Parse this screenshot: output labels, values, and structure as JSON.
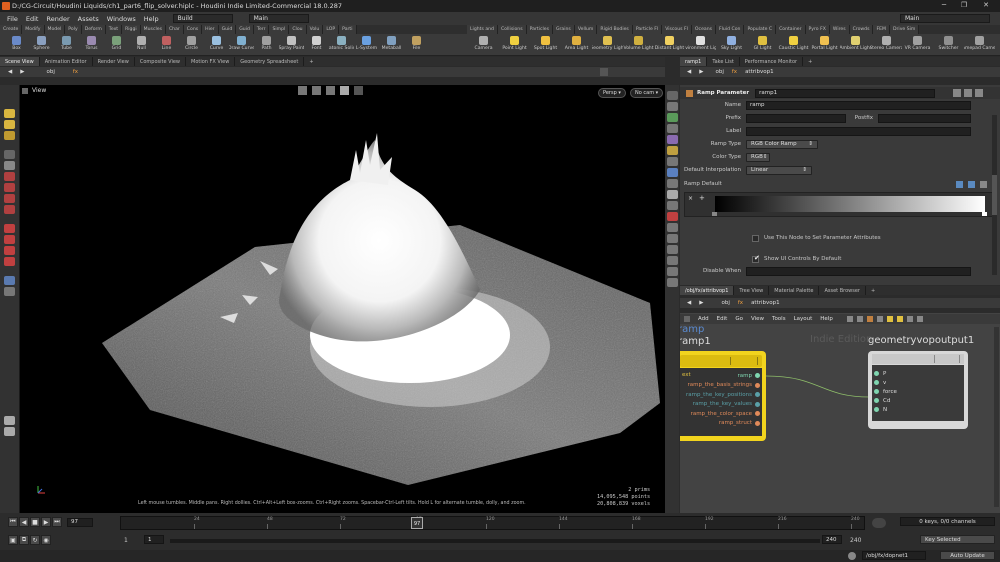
{
  "window": {
    "title": "D:/CG-Circuit/Houdini Liquids/ch1_part6_flip_solver.hiplc - Houdini Indie Limited-Commercial 18.0.287",
    "controls": [
      "─",
      "❐",
      "✕"
    ]
  },
  "menubar": {
    "items": [
      "File",
      "Edit",
      "Render",
      "Assets",
      "Windows",
      "Help"
    ],
    "desktop": "Build",
    "context": "Main",
    "right_context": "Main"
  },
  "shelf_tabs_left": [
    "Create",
    "Modify",
    "Model",
    "Poly",
    "Deform",
    "Text",
    "Riggi",
    "Muscles",
    "Char",
    "Cons",
    "Hier",
    "Guid",
    "Guid",
    "Terr",
    "Simpl",
    "Clou",
    "Volu",
    "LOP",
    "Parti"
  ],
  "shelf_tabs_right": [
    "Lights and",
    "Collisions",
    "Particles",
    "Grains",
    "Vellum",
    "Rigid Bodies",
    "Particle Fl",
    "Viscous Fl",
    "Oceans",
    "Fluid Con",
    "Populate C",
    "Container",
    "Pyro FX",
    "Wires",
    "Crowds",
    "FEM",
    "Drive Sim"
  ],
  "shelf_tools_left": [
    {
      "label": "Box",
      "icon": "box-icon"
    },
    {
      "label": "Sphere",
      "icon": "sphere-icon"
    },
    {
      "label": "Tube",
      "icon": "tube-icon"
    },
    {
      "label": "Torus",
      "icon": "torus-icon"
    },
    {
      "label": "Grid",
      "icon": "grid-icon"
    },
    {
      "label": "Null",
      "icon": "null-icon"
    },
    {
      "label": "Line",
      "icon": "line-icon"
    },
    {
      "label": "Circle",
      "icon": "circle-icon"
    },
    {
      "label": "Curve",
      "icon": "curve-icon"
    },
    {
      "label": "Draw Curve",
      "icon": "draw-curve-icon"
    },
    {
      "label": "Path",
      "icon": "path-icon"
    },
    {
      "label": "Spray Paint",
      "icon": "spray-paint-icon"
    },
    {
      "label": "Font",
      "icon": "font-icon"
    },
    {
      "label": "Platonic Solids",
      "icon": "platonic-icon"
    },
    {
      "label": "L-System",
      "icon": "lsystem-icon"
    },
    {
      "label": "Metaball",
      "icon": "metaball-icon"
    },
    {
      "label": "File",
      "icon": "file-icon"
    }
  ],
  "shelf_tools_right": [
    {
      "label": "Camera",
      "icon": "camera-icon"
    },
    {
      "label": "Point Light",
      "icon": "point-light-icon"
    },
    {
      "label": "Spot Light",
      "icon": "spot-light-icon"
    },
    {
      "label": "Area Light",
      "icon": "area-light-icon"
    },
    {
      "label": "Geometry Light",
      "icon": "geometry-light-icon"
    },
    {
      "label": "Volume Light",
      "icon": "volume-light-icon"
    },
    {
      "label": "Distant Light",
      "icon": "distant-light-icon"
    },
    {
      "label": "Environment Light",
      "icon": "env-light-icon"
    },
    {
      "label": "Sky Light",
      "icon": "sky-light-icon"
    },
    {
      "label": "GI Light",
      "icon": "gi-light-icon"
    },
    {
      "label": "Caustic Light",
      "icon": "caustic-light-icon"
    },
    {
      "label": "Portal Light",
      "icon": "portal-light-icon"
    },
    {
      "label": "Ambient Light",
      "icon": "ambient-light-icon"
    },
    {
      "label": "Stereo Camera",
      "icon": "stereo-camera-icon"
    },
    {
      "label": "VR Camera",
      "icon": "vr-camera-icon"
    },
    {
      "label": "Switcher",
      "icon": "switcher-icon"
    },
    {
      "label": "Gamepad Camera",
      "icon": "gamepad-camera-icon"
    }
  ],
  "left_tabs": [
    "Scene View",
    "Animation Editor",
    "Render View",
    "Composite View",
    "Motion FX View",
    "Geometry Spreadsheet"
  ],
  "left_path": {
    "obj": "obj",
    "node": "fx"
  },
  "viewport": {
    "label": "View",
    "persp": "Persp",
    "cam": "No cam",
    "hint": "Left mouse tumbles. Middle pans. Right dollies. Ctrl+Alt+Left box-zooms. Ctrl+Right zooms. Spacebar-Ctrl-Left tilts. Hold L for alternate tumble, dolly, and zoom.",
    "stats": {
      "prims_count": "2",
      "prims_label": "prims",
      "points_count": "14,095,548",
      "points_label": "points",
      "voxels_count": "20,808,839",
      "voxels_label": "voxels"
    }
  },
  "right_top_tabs": [
    "ramp1",
    "Take List",
    "Performance Monitor"
  ],
  "right_top_path": {
    "obj": "obj",
    "fx": "fx",
    "node": "attribvop1"
  },
  "params": {
    "node_type": "Ramp Parameter",
    "node_name": "ramp1",
    "name_label": "Name",
    "name_value": "ramp",
    "prefix_label": "Prefix",
    "postfix_label": "Postfix",
    "label_label": "Label",
    "ramp_type_label": "Ramp Type",
    "ramp_type_value": "RGB Color Ramp",
    "color_type_label": "Color Type",
    "color_type_value": "RGB",
    "interp_label": "Default Interpolation",
    "interp_value": "Linear",
    "ramp_default_label": "Ramp Default",
    "use_node_label": "Use This Node to Set Parameter Attributes",
    "show_ui_label": "Show UI Controls By Default",
    "disable_label": "Disable When"
  },
  "right_bottom_tabs": [
    "/obj/fx/attribvop1",
    "Tree View",
    "Material Palette",
    "Asset Browser"
  ],
  "right_bottom_path": {
    "obj": "obj",
    "fx": "fx",
    "node": "attribvop1"
  },
  "network": {
    "menus": [
      "Add",
      "Edit",
      "Go",
      "View",
      "Tools",
      "Layout",
      "Help"
    ],
    "watermark": "Indie Edition",
    "ramp_node": {
      "title_a": "ramp",
      "title_b": "ramp1",
      "outputs": [
        {
          "name": "ramp",
          "color": "#7fd6b0"
        },
        {
          "name": "ramp_the_basis_strings",
          "color": "#e08a5a"
        },
        {
          "name": "ramp_the_key_positions",
          "color": "#5aa0a8"
        },
        {
          "name": "ramp_the_key_values",
          "color": "#5aa0a8"
        },
        {
          "name": "ramp_the_color_space",
          "color": "#e08a5a"
        },
        {
          "name": "ramp_struct",
          "color": "#e08a5a"
        }
      ],
      "input_label": "ext"
    },
    "output_node": {
      "title": "geometryvopoutput1",
      "inputs": [
        "P",
        "v",
        "force",
        "Cd",
        "N"
      ]
    }
  },
  "timeline": {
    "frame": "97",
    "ticks": [
      "24",
      "48",
      "72",
      "97",
      "120",
      "144",
      "168",
      "192",
      "216",
      "240"
    ],
    "current_marker": "97",
    "start": "1",
    "start2": "1",
    "end": "240",
    "end2": "240",
    "keys_label": "0 keys, 0/0 channels",
    "key_mode": "Key Selected",
    "path": "/obj/fx/dopnet1",
    "update": "Auto Update"
  },
  "colors": {
    "accent": "#f0d040",
    "node_yellow": "#f2d41e",
    "wire": "#8fbf6a"
  }
}
